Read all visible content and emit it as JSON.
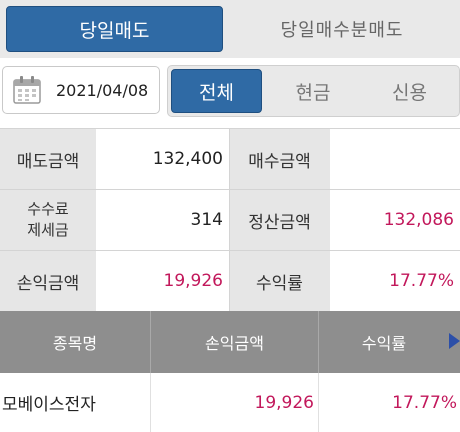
{
  "top_tabs": {
    "primary": "당일매도",
    "secondary": "당일매수분매도"
  },
  "filter": {
    "date": "2021/04/08",
    "segments": [
      "전체",
      "현금",
      "신용"
    ],
    "active_segment": "전체"
  },
  "summary": {
    "sell_amount_label": "매도금액",
    "sell_amount": "132,400",
    "buy_amount_label": "매수금액",
    "buy_amount": "",
    "fee_label_line1": "수수료",
    "fee_label_line2": "제세금",
    "fee": "314",
    "settle_label": "정산금액",
    "settle_amount": "132,086",
    "pnl_label": "손익금액",
    "pnl": "19,926",
    "rate_label": "수익률",
    "rate": "17.77%"
  },
  "table": {
    "columns": [
      "종목명",
      "손익금액",
      "수익률"
    ],
    "rows": [
      {
        "name": "모베이스전자",
        "pnl": "19,926",
        "rate": "17.77%"
      }
    ]
  },
  "colors": {
    "accent_blue": "#2f6aa5",
    "positive_pink": "#c2185b",
    "header_gray": "#8e8e8e"
  }
}
